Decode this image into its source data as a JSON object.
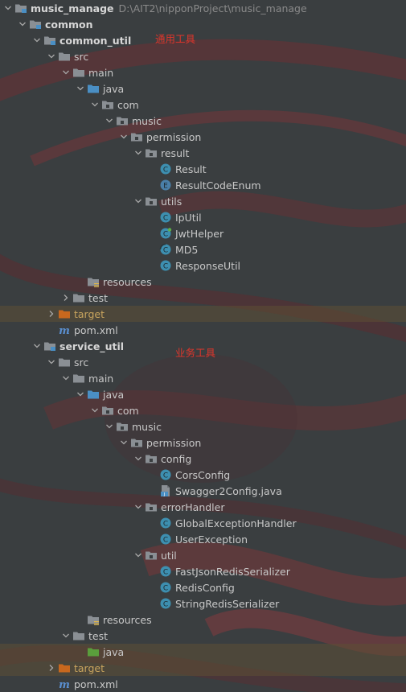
{
  "project": {
    "name": "music_manage",
    "path": "D:\\AIT2\\nipponProject\\music_manage"
  },
  "annotations": {
    "common_util": "通用工具",
    "service_util": "业务工具"
  },
  "tree": [
    {
      "id": "music_manage",
      "label": "music_manage",
      "level": 0,
      "arrow": "down",
      "icon": "module-folder",
      "bold": true,
      "path": "D:\\AIT2\\nipponProject\\music_manage"
    },
    {
      "id": "common",
      "label": "common",
      "level": 1,
      "arrow": "down",
      "icon": "module-folder",
      "bold": true
    },
    {
      "id": "common_util",
      "label": "common_util",
      "level": 2,
      "arrow": "down",
      "icon": "module-folder",
      "bold": true
    },
    {
      "id": "src",
      "label": "src",
      "level": 3,
      "arrow": "down",
      "icon": "folder"
    },
    {
      "id": "main",
      "label": "main",
      "level": 4,
      "arrow": "down",
      "icon": "folder"
    },
    {
      "id": "java",
      "label": "java",
      "level": 5,
      "arrow": "down",
      "icon": "source-folder"
    },
    {
      "id": "com",
      "label": "com",
      "level": 6,
      "arrow": "down",
      "icon": "package"
    },
    {
      "id": "music",
      "label": "music",
      "level": 7,
      "arrow": "down",
      "icon": "package"
    },
    {
      "id": "permission",
      "label": "permission",
      "level": 8,
      "arrow": "down",
      "icon": "package"
    },
    {
      "id": "result",
      "label": "result",
      "level": 9,
      "arrow": "down",
      "icon": "package"
    },
    {
      "id": "Result",
      "label": "Result",
      "level": 10,
      "arrow": "none",
      "icon": "class"
    },
    {
      "id": "ResultCodeEnum",
      "label": "ResultCodeEnum",
      "level": 10,
      "arrow": "none",
      "icon": "enum"
    },
    {
      "id": "utils",
      "label": "utils",
      "level": 9,
      "arrow": "down",
      "icon": "package"
    },
    {
      "id": "IpUtil",
      "label": "IpUtil",
      "level": 10,
      "arrow": "none",
      "icon": "class"
    },
    {
      "id": "JwtHelper",
      "label": "JwtHelper",
      "level": 10,
      "arrow": "none",
      "icon": "class-modified"
    },
    {
      "id": "MD5",
      "label": "MD5",
      "level": 10,
      "arrow": "none",
      "icon": "class-abstract"
    },
    {
      "id": "ResponseUtil",
      "label": "ResponseUtil",
      "level": 10,
      "arrow": "none",
      "icon": "class"
    },
    {
      "id": "resources",
      "label": "resources",
      "level": 5,
      "arrow": "none",
      "icon": "resources-folder"
    },
    {
      "id": "test",
      "label": "test",
      "level": 4,
      "arrow": "right",
      "icon": "folder"
    },
    {
      "id": "target",
      "label": "target",
      "level": 3,
      "arrow": "right",
      "icon": "excluded-folder",
      "excluded": true
    },
    {
      "id": "pom",
      "label": "pom.xml",
      "level": 3,
      "arrow": "none",
      "icon": "maven"
    },
    {
      "id": "service_util",
      "label": "service_util",
      "level": 2,
      "arrow": "down",
      "icon": "module-folder",
      "bold": true
    },
    {
      "id": "src2",
      "label": "src",
      "level": 3,
      "arrow": "down",
      "icon": "folder"
    },
    {
      "id": "main2",
      "label": "main",
      "level": 4,
      "arrow": "down",
      "icon": "folder"
    },
    {
      "id": "java2",
      "label": "java",
      "level": 5,
      "arrow": "down",
      "icon": "source-folder"
    },
    {
      "id": "com2",
      "label": "com",
      "level": 6,
      "arrow": "down",
      "icon": "package"
    },
    {
      "id": "music2",
      "label": "music",
      "level": 7,
      "arrow": "down",
      "icon": "package"
    },
    {
      "id": "permission2",
      "label": "permission",
      "level": 8,
      "arrow": "down",
      "icon": "package"
    },
    {
      "id": "config",
      "label": "config",
      "level": 9,
      "arrow": "down",
      "icon": "package"
    },
    {
      "id": "CorsConfig",
      "label": "CorsConfig",
      "level": 10,
      "arrow": "none",
      "icon": "class"
    },
    {
      "id": "Swagger2Config",
      "label": "Swagger2Config.java",
      "level": 10,
      "arrow": "none",
      "icon": "java-file"
    },
    {
      "id": "errorHandler",
      "label": "errorHandler",
      "level": 9,
      "arrow": "down",
      "icon": "package"
    },
    {
      "id": "GlobalExceptionHandler",
      "label": "GlobalExceptionHandler",
      "level": 10,
      "arrow": "none",
      "icon": "class"
    },
    {
      "id": "UserException",
      "label": "UserException",
      "level": 10,
      "arrow": "none",
      "icon": "class"
    },
    {
      "id": "util",
      "label": "util",
      "level": 9,
      "arrow": "down",
      "icon": "package"
    },
    {
      "id": "FastJsonRedisSerializer",
      "label": "FastJsonRedisSerializer",
      "level": 10,
      "arrow": "none",
      "icon": "class"
    },
    {
      "id": "RedisConfig",
      "label": "RedisConfig",
      "level": 10,
      "arrow": "none",
      "icon": "class"
    },
    {
      "id": "StringRedisSerializer",
      "label": "StringRedisSerializer",
      "level": 10,
      "arrow": "none",
      "icon": "class"
    },
    {
      "id": "resources2",
      "label": "resources",
      "level": 5,
      "arrow": "none",
      "icon": "resources-folder"
    },
    {
      "id": "test2",
      "label": "test",
      "level": 4,
      "arrow": "down",
      "icon": "folder"
    },
    {
      "id": "testjava",
      "label": "java",
      "level": 5,
      "arrow": "none",
      "icon": "test-source-folder",
      "highlight": true
    },
    {
      "id": "target2",
      "label": "target",
      "level": 3,
      "arrow": "right",
      "icon": "excluded-folder",
      "excluded": true
    },
    {
      "id": "pom2",
      "label": "pom.xml",
      "level": 3,
      "arrow": "none",
      "icon": "maven"
    }
  ],
  "colors": {
    "class": "#3d8fb0",
    "enum": "#4a7fa8",
    "folder": "#8a8f94",
    "source-folder": "#4a8fc4",
    "test-folder": "#5a9e3c",
    "excluded": "#c8681e",
    "annotation": "#e0352b"
  }
}
